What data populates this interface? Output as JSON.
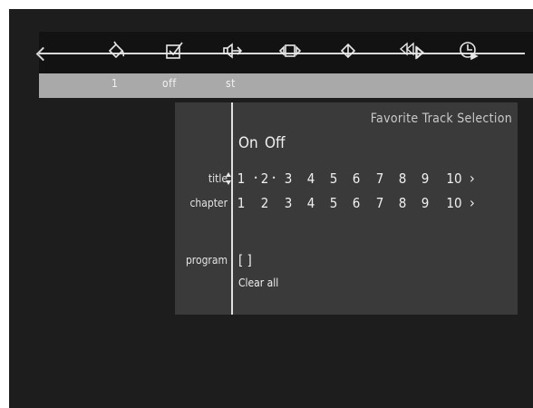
{
  "toolbar": {
    "icons": [
      "fill-bucket-icon",
      "checkbox-icon",
      "speaker-arrow-icon",
      "segment-icon",
      "diamond-cursor-icon",
      "rewind-icon",
      "clock-play-icon"
    ],
    "values": {
      "bucket": "1",
      "checkbox": "off",
      "speaker": "st"
    }
  },
  "dialog": {
    "title": "Favorite Track Selection",
    "on_label": "On",
    "off_label": "Off",
    "title_label": "title",
    "chapter_label": "chapter",
    "program_label": "program",
    "numbers": [
      "1",
      "2",
      "3",
      "4",
      "5",
      "6",
      "7",
      "8",
      "9",
      "10"
    ],
    "selected_title": "2",
    "program_value": "[ ]",
    "clear_all": "Clear all"
  }
}
